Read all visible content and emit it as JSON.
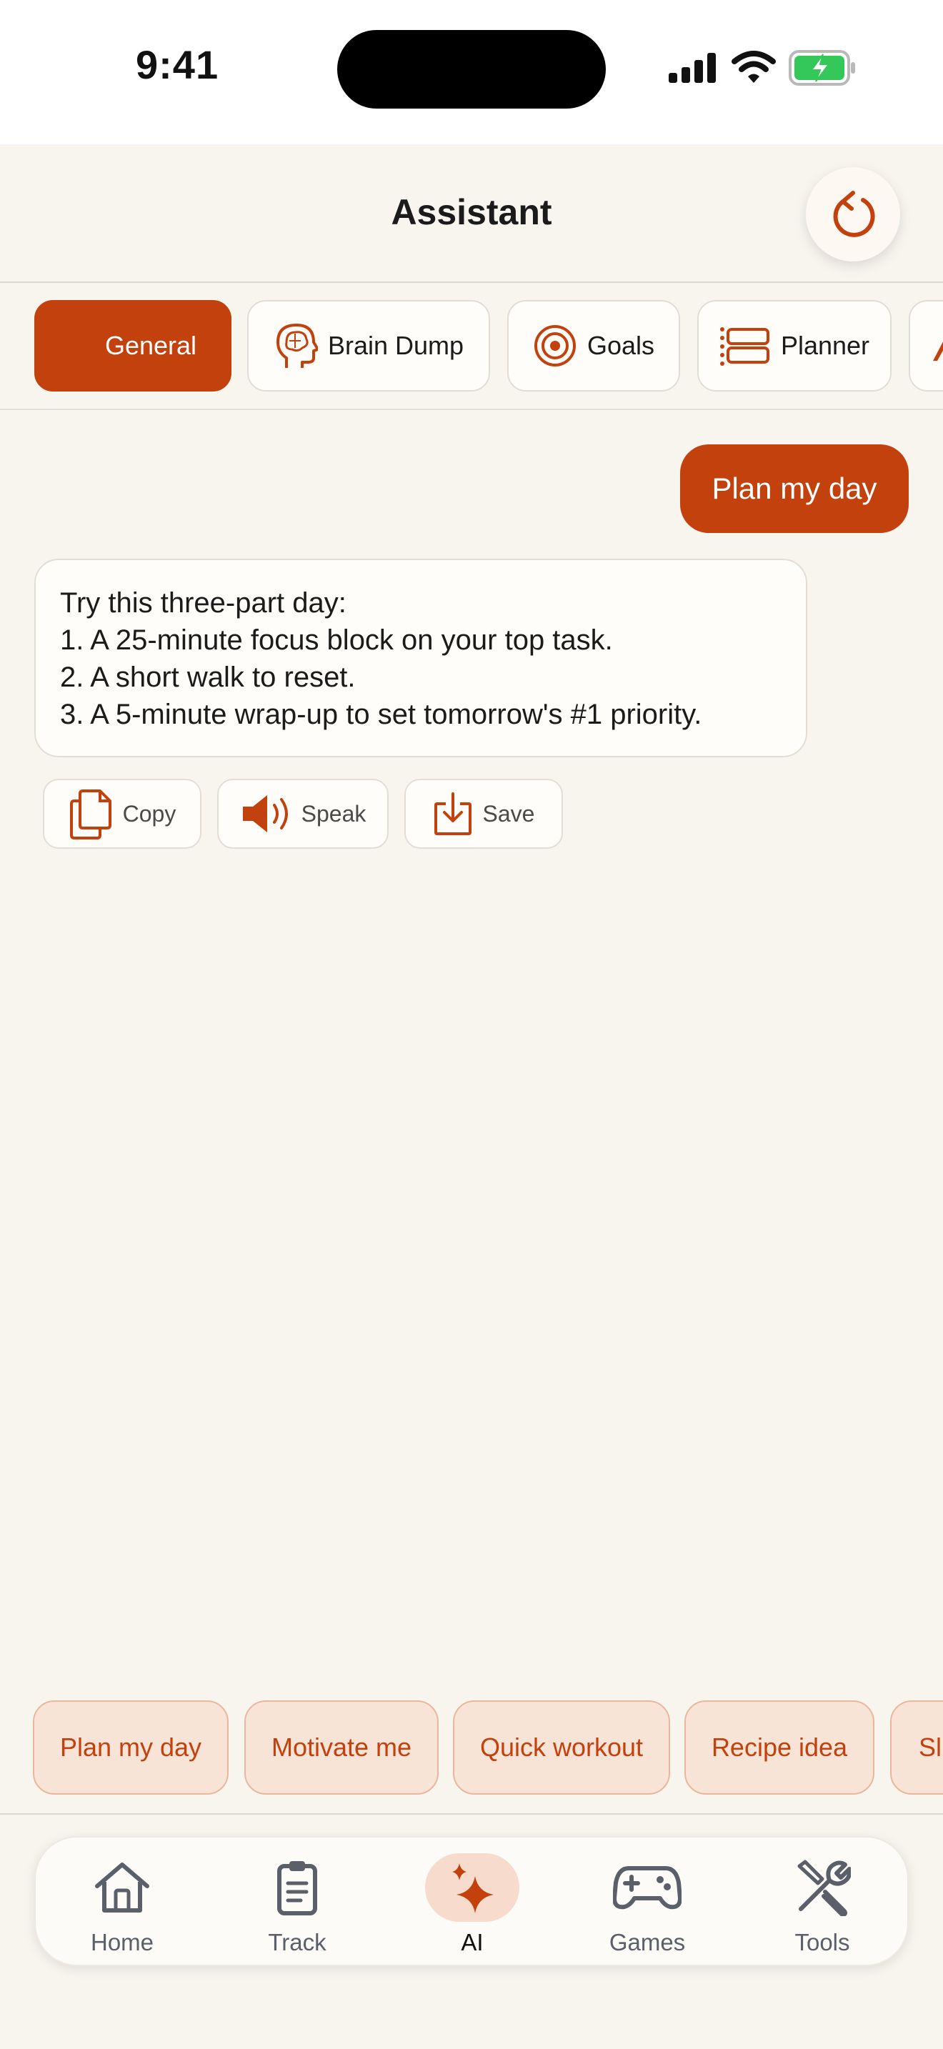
{
  "status_bar": {
    "time": "9:41",
    "icons": [
      "signal-icon",
      "wifi-icon",
      "battery-charging-icon"
    ]
  },
  "header": {
    "title": "Assistant",
    "reset_icon": "refresh-icon"
  },
  "modes": [
    {
      "label": "General",
      "icon": "",
      "active": true
    },
    {
      "label": "Brain Dump",
      "icon": "brain-icon",
      "active": false
    },
    {
      "label": "Goals",
      "icon": "target-icon",
      "active": false
    },
    {
      "label": "Planner",
      "icon": "planner-icon",
      "active": false
    }
  ],
  "chat": {
    "user_message": "Plan my day",
    "assistant_lines": [
      "Try this three-part day:",
      "1. A 25-minute focus block on your top task.",
      "2. A short walk to reset.",
      "3. A 5-minute wrap-up to set tomorrow's #1 priority."
    ]
  },
  "actions": [
    {
      "label": "Copy",
      "icon": "copy-icon"
    },
    {
      "label": "Speak",
      "icon": "speaker-icon"
    },
    {
      "label": "Save",
      "icon": "save-icon"
    }
  ],
  "suggestions": [
    "Plan my day",
    "Motivate me",
    "Quick workout",
    "Recipe idea",
    "Sl"
  ],
  "nav": [
    {
      "label": "Home",
      "icon": "home-icon",
      "active": false
    },
    {
      "label": "Track",
      "icon": "clipboard-icon",
      "active": false
    },
    {
      "label": "AI",
      "icon": "sparkle-icon",
      "active": true
    },
    {
      "label": "Games",
      "icon": "gamepad-icon",
      "active": false
    },
    {
      "label": "Tools",
      "icon": "tools-icon",
      "active": false
    }
  ],
  "colors": {
    "accent": "#c2410c",
    "background": "#f8f5ef",
    "chip_bg": "#f8e3d7",
    "battery": "#34c759"
  }
}
